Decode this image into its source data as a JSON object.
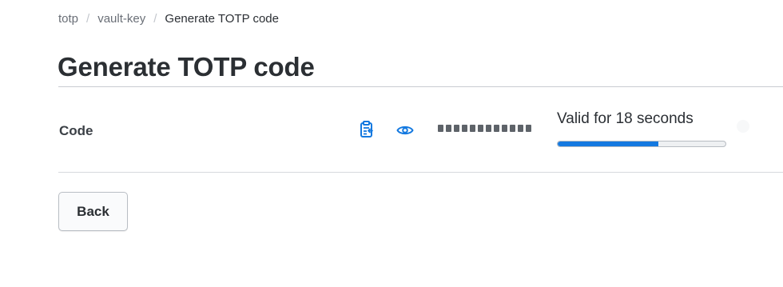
{
  "breadcrumb": {
    "items": [
      "totp",
      "vault-key"
    ],
    "current": "Generate TOTP code",
    "separator": "/"
  },
  "page": {
    "title": "Generate TOTP code"
  },
  "code_row": {
    "label": "Code",
    "copy_icon": "clipboard-copy-icon",
    "reveal_icon": "eye-icon",
    "masked_length": 12,
    "ttl_text": "Valid for 18 seconds",
    "ttl_progress_percent": 60
  },
  "actions": {
    "back_label": "Back"
  },
  "colors": {
    "accent": "#1479e0",
    "text": "#2b2f33",
    "muted": "#6a6f77",
    "rule": "#c8ccd1"
  }
}
